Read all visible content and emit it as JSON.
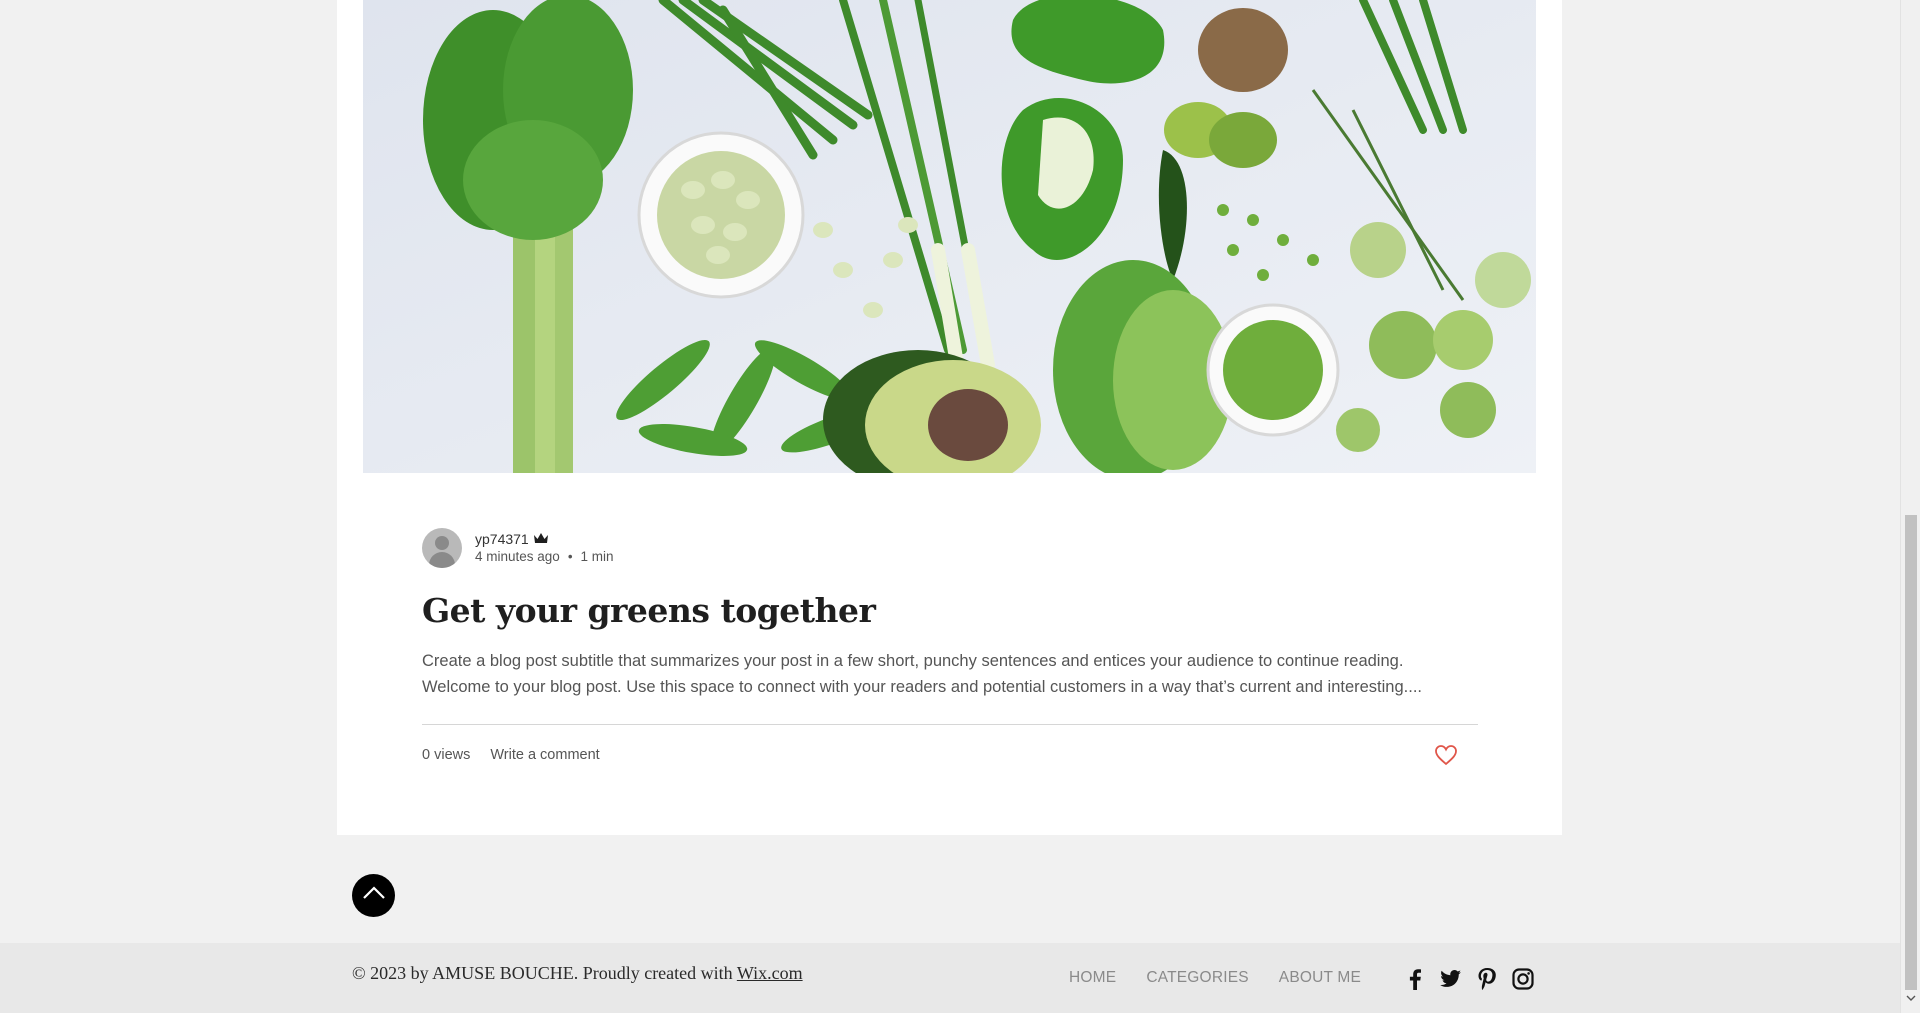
{
  "post": {
    "author": "yp74371",
    "time_ago": "4 minutes ago",
    "separator": "•",
    "read_time": "1 min",
    "title": "Get your greens together",
    "excerpt_line1": "Create a blog post subtitle that summarizes your post in a few short, punchy sentences and entices your audience to continue reading.",
    "excerpt_line2": "Welcome to your blog post. Use this space to connect with your readers and potential customers in a way that’s current and interesting....",
    "views": "0 views",
    "comment_link": "Write a comment"
  },
  "footer": {
    "copyright_prefix": "© 2023 by AMUSE BOUCHE. Proudly created with ",
    "copyright_link": "Wix.com",
    "nav": [
      "HOME",
      "CATEGORIES",
      "ABOUT ME"
    ],
    "social_icons": [
      "facebook-icon",
      "twitter-icon",
      "pinterest-icon",
      "instagram-icon"
    ]
  },
  "colors": {
    "page_bg": "#f1f1f1",
    "card_bg": "#ffffff",
    "heart": "#e0564a",
    "footer_bg": "#e8e8e8"
  }
}
